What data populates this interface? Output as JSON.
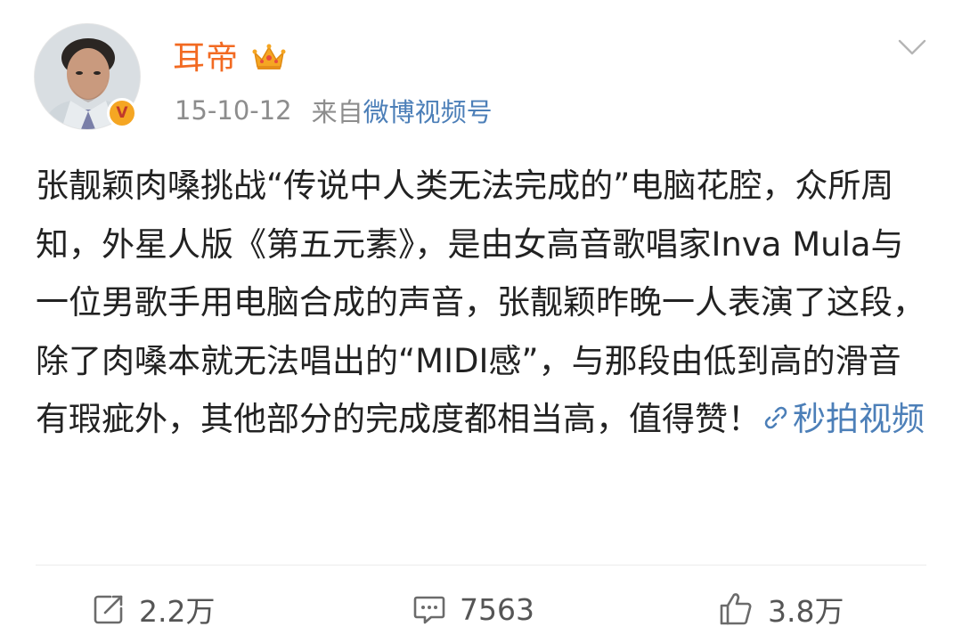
{
  "post": {
    "author": {
      "name": "耳帝",
      "verified_badge": "V",
      "crown_icon": "crown-icon"
    },
    "meta": {
      "timestamp": "15-10-12",
      "source_prefix": "来自",
      "source_name": "微博视频号"
    },
    "content": {
      "text": "张靓颖肉嗓挑战“传说中人类无法完成的”电脑花腔，众所周知，外星人版《第五元素》，是由女高音歌唱家Inva Mula与一位男歌手用电脑合成的声音，张靓颖昨晚一人表演了这段，除了肉嗓本就无法唱出的“MIDI感”，与那段由低到高的滑音有瑕疵外，其他部分的完成度都相当高，值得赞！",
      "video_link_label": "秒拍视频"
    },
    "actions": {
      "repost_count": "2.2万",
      "comment_count": "7563",
      "like_count": "3.8万"
    }
  },
  "colors": {
    "username": "#f26a22",
    "link": "#4c7fb8",
    "meta": "#8d8d8d",
    "badge": "#f5a623"
  }
}
